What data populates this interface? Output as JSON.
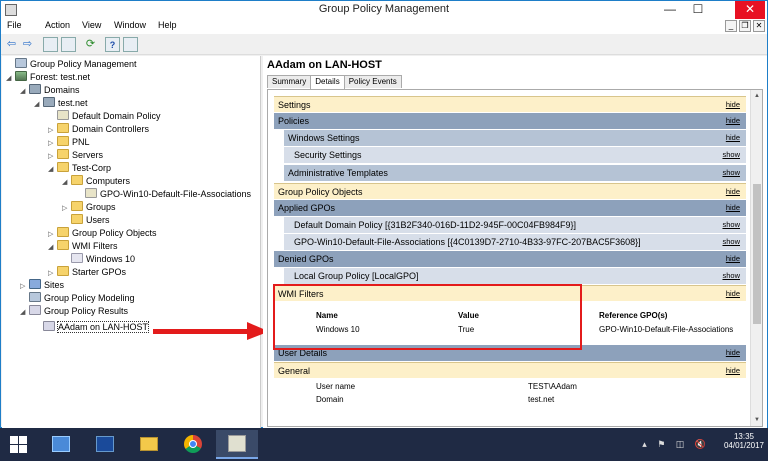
{
  "window": {
    "title": "Group Policy Management"
  },
  "menu": [
    "File",
    "Action",
    "View",
    "Window",
    "Help"
  ],
  "titlebar_buttons": {
    "minimize": "—",
    "maximize": "☐",
    "close": "✕"
  },
  "inner_buttons": {
    "minimize": "_",
    "restore": "❐",
    "close": "✕"
  },
  "toolbar": {
    "back": "⇦",
    "forward": "⇨",
    "refresh": "⟳",
    "help": "?"
  },
  "tree": [
    {
      "label": "Group Policy Management",
      "icon": "gpm-icon",
      "exp": ""
    },
    {
      "label": "Forest: test.net",
      "icon": "forest-icon",
      "exp": "◢"
    },
    {
      "label": "Domains",
      "icon": "domain-icon",
      "exp": "◢"
    },
    {
      "label": "test.net",
      "icon": "domain-icon",
      "exp": "◢"
    },
    {
      "label": "Default Domain Policy",
      "icon": "gpo-icon",
      "exp": ""
    },
    {
      "label": "Domain Controllers",
      "icon": "folder-icon",
      "exp": "▷"
    },
    {
      "label": "PNL",
      "icon": "folder-icon",
      "exp": "▷"
    },
    {
      "label": "Servers",
      "icon": "folder-icon",
      "exp": "▷"
    },
    {
      "label": "Test-Corp",
      "icon": "folder-icon",
      "exp": "◢"
    },
    {
      "label": "Computers",
      "icon": "folder-icon",
      "exp": "◢"
    },
    {
      "label": "GPO-Win10-Default-File-Associations",
      "icon": "gpo-icon",
      "exp": ""
    },
    {
      "label": "Groups",
      "icon": "folder-icon",
      "exp": "▷"
    },
    {
      "label": "Users",
      "icon": "folder-icon",
      "exp": ""
    },
    {
      "label": "Group Policy Objects",
      "icon": "folder-icon",
      "exp": "▷"
    },
    {
      "label": "WMI Filters",
      "icon": "folder-icon",
      "exp": "◢"
    },
    {
      "label": "Windows 10",
      "icon": "wmi-icon",
      "exp": ""
    },
    {
      "label": "Starter GPOs",
      "icon": "folder-icon",
      "exp": "▷"
    },
    {
      "label": "Sites",
      "icon": "sites-icon",
      "exp": "▷"
    },
    {
      "label": "Group Policy Modeling",
      "icon": "gpm-icon",
      "exp": ""
    },
    {
      "label": "Group Policy Results",
      "icon": "result-icon",
      "exp": "◢"
    },
    {
      "label": "AAdam on LAN-HOST",
      "icon": "result-icon",
      "exp": ""
    }
  ],
  "right": {
    "title": "AAdam on LAN-HOST",
    "tabs": [
      "Summary",
      "Details",
      "Policy Events"
    ],
    "sections": [
      {
        "label": "Settings",
        "ctrl": "hide",
        "level": 1
      },
      {
        "label": "Policies",
        "ctrl": "hide",
        "level": 2
      },
      {
        "label": "Windows Settings",
        "ctrl": "hide",
        "level": 3
      },
      {
        "label": "Security Settings",
        "ctrl": "show",
        "level": 4
      },
      {
        "label": "Administrative Templates",
        "ctrl": "show",
        "level": 3
      },
      {
        "label": "Group Policy Objects",
        "ctrl": "hide",
        "level": 1
      },
      {
        "label": "Applied GPOs",
        "ctrl": "hide",
        "level": 2
      },
      {
        "label": "Default Domain Policy [{31B2F340-016D-11D2-945F-00C04FB984F9}]",
        "ctrl": "show",
        "level": 4
      },
      {
        "label": "GPO-Win10-Default-File-Associations [{4C0139D7-2710-4B33-97FC-207BAC5F3608}]",
        "ctrl": "show",
        "level": 4
      },
      {
        "label": "Denied GPOs",
        "ctrl": "hide",
        "level": 2
      },
      {
        "label": "Local Group Policy [LocalGPO]",
        "ctrl": "show",
        "level": 4
      },
      {
        "label": "WMI Filters",
        "ctrl": "hide",
        "level": 1
      }
    ],
    "wmi": {
      "headers": [
        "Name",
        "Value",
        "Reference GPO(s)"
      ],
      "row": [
        "Windows 10",
        "True",
        "GPO-Win10-Default-File-Associations"
      ]
    },
    "user_details": {
      "label": "User Details",
      "ctrl": "hide"
    },
    "general": {
      "label": "General",
      "ctrl": "hide"
    },
    "kv": [
      {
        "k": "User name",
        "v": "TEST\\AAdam"
      },
      {
        "k": "Domain",
        "v": "test.net"
      }
    ]
  },
  "taskbar": {
    "time": "13:35",
    "date": "04/01/2017"
  },
  "colors": {
    "highlight": "#e31b1b",
    "taskbar": "#1f2a44"
  }
}
